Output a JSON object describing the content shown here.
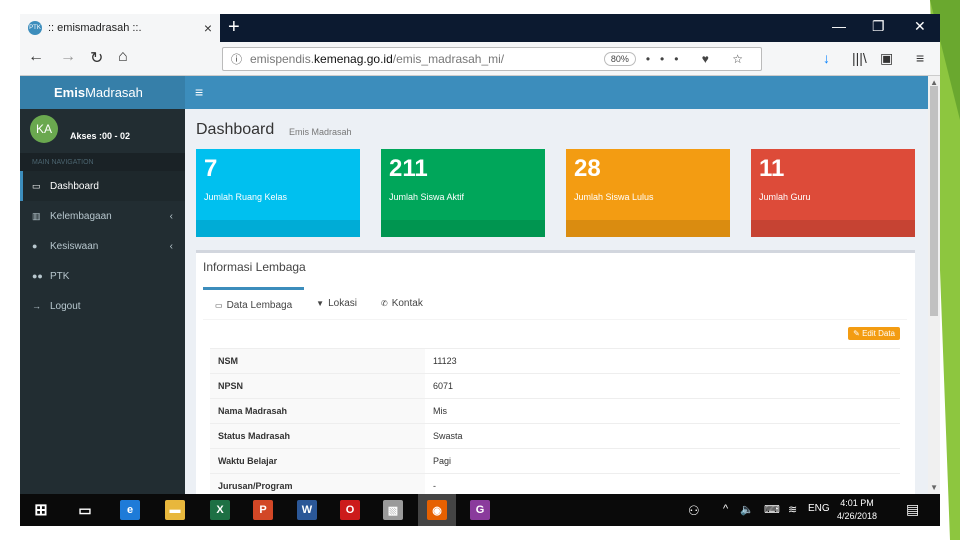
{
  "browser": {
    "tab_title": ":: emismadrasah ::.",
    "tab_close": "×",
    "new_tab": "+",
    "minimize": "—",
    "restore": "❐",
    "close": "✕",
    "back": "←",
    "forward": "→",
    "reload": "↻",
    "home": "⌂",
    "url_prefix": "emispendis.",
    "url_domain": "kemenag.go.id",
    "url_path": "/emis_madrasah_mi/",
    "zoom": "80%",
    "page_actions": "••• ♥ ☆",
    "download": "↓",
    "library": "|||\\",
    "sidebar_toggle": "▣",
    "menu": "≡",
    "favicon": "PTK"
  },
  "app": {
    "logo_bold": "Emis",
    "logo_rest": "Madrasah",
    "hamburger": "≡"
  },
  "sidebar": {
    "avatar": "KA",
    "akses": "Akses :00 - 02",
    "nav_header": "MAIN NAVIGATION",
    "items": [
      {
        "icon": "▭",
        "label": "Dashboard",
        "chevron": ""
      },
      {
        "icon": "▥",
        "label": "Kelembagaan",
        "chevron": "‹"
      },
      {
        "icon": "●",
        "label": "Kesiswaan",
        "chevron": "‹"
      },
      {
        "icon": "●●",
        "label": "PTK",
        "chevron": ""
      },
      {
        "icon": "→",
        "label": "Logout",
        "chevron": ""
      }
    ]
  },
  "page": {
    "title": "Dashboard",
    "subtitle": "Emis Madrasah"
  },
  "stats": [
    {
      "value": "7",
      "label": "Jumlah Ruang Kelas",
      "color": "#00c0ef"
    },
    {
      "value": "211",
      "label": "Jumlah Siswa Aktif",
      "color": "#00a65a"
    },
    {
      "value": "28",
      "label": "Jumlah Siswa Lulus",
      "color": "#f39c12"
    },
    {
      "value": "11",
      "label": "Jumlah Guru",
      "color": "#dd4b39"
    }
  ],
  "info": {
    "title": "Informasi Lembaga",
    "tabs": [
      {
        "icon": "▭",
        "label": "Data Lembaga"
      },
      {
        "icon": "▼",
        "label": "Lokasi"
      },
      {
        "icon": "✆",
        "label": "Kontak"
      }
    ],
    "edit_button": "✎ Edit Data",
    "rows": [
      {
        "key": "NSM",
        "value": "11123"
      },
      {
        "key": "NPSN",
        "value": "6071"
      },
      {
        "key": "Nama Madrasah",
        "value": "Mis"
      },
      {
        "key": "Status Madrasah",
        "value": "Swasta"
      },
      {
        "key": "Waktu Belajar",
        "value": "Pagi"
      },
      {
        "key": "Jurusan/Program",
        "value": "-"
      }
    ]
  },
  "taskbar": {
    "start": "⊞",
    "taskview": "▭",
    "apps": [
      {
        "label": "e",
        "color": "#1e7bd8"
      },
      {
        "label": "▬",
        "color": "#e8b73c"
      },
      {
        "label": "X",
        "color": "#1d7044"
      },
      {
        "label": "P",
        "color": "#d24726"
      },
      {
        "label": "W",
        "color": "#2b5797"
      },
      {
        "label": "O",
        "color": "#cc1b1b"
      },
      {
        "label": "▧",
        "color": "#9a9a9a"
      },
      {
        "label": "◉",
        "color": "#e66000"
      },
      {
        "label": "G",
        "color": "#8a3b9c"
      }
    ],
    "tray_people": "⚇",
    "tray_up": "^",
    "tray_volume": "🔈",
    "tray_keyboard": "⌨",
    "tray_wifi": "≋",
    "lang": "ENG",
    "time": "4:01 PM",
    "date": "4/26/2018",
    "notif": "▤"
  }
}
